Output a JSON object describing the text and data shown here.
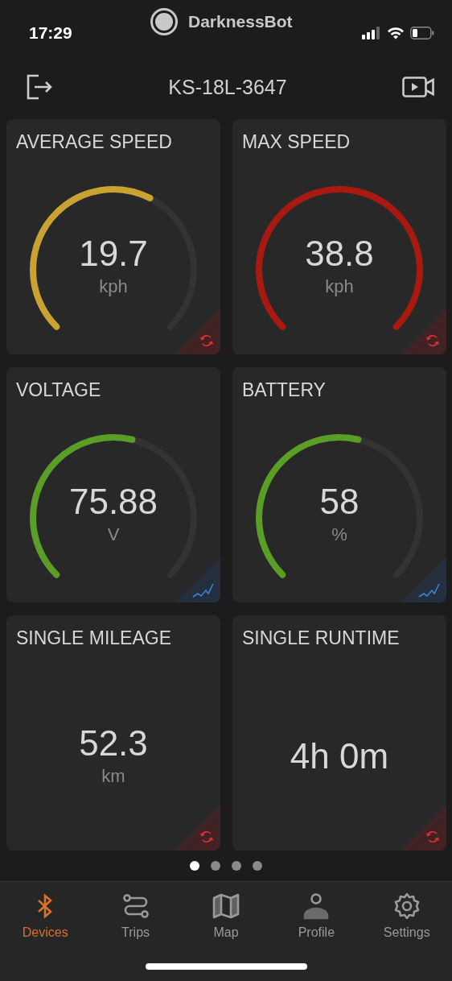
{
  "status_bar": {
    "time": "17:29",
    "app": "DarknessBot"
  },
  "header": {
    "title": "KS-18L-3647"
  },
  "cards": [
    {
      "kind": "gauge",
      "title": "AVERAGE SPEED",
      "value": "19.7",
      "unit": "kph",
      "color": "#c9a231"
    },
    {
      "kind": "gauge",
      "title": "MAX SPEED",
      "value": "38.8",
      "unit": "kph",
      "color": "#a8190f"
    },
    {
      "kind": "gauge",
      "title": "VOLTAGE",
      "value": "75.88",
      "unit": "V",
      "color": "#5a9e26"
    },
    {
      "kind": "gauge",
      "title": "BATTERY",
      "value": "58",
      "unit": "%",
      "color": "#5a9e26"
    },
    {
      "kind": "plain",
      "title": "SINGLE MILEAGE",
      "value": "52.3",
      "unit": "km"
    },
    {
      "kind": "plain",
      "title": "SINGLE RUNTIME",
      "value": "4h 0m"
    }
  ],
  "pages": [
    {
      "selected": true
    },
    {
      "selected": false
    },
    {
      "selected": false
    },
    {
      "selected": false
    }
  ],
  "tabs": [
    {
      "label": "Devices",
      "selected": true
    },
    {
      "label": "Trips",
      "selected": false
    },
    {
      "label": "Map",
      "selected": false
    },
    {
      "label": "Profile",
      "selected": false
    },
    {
      "label": "Settings",
      "selected": false
    }
  ]
}
